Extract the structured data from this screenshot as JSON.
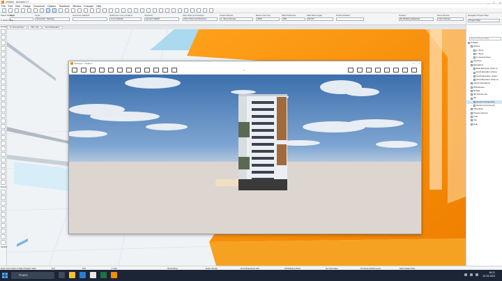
{
  "app": {
    "title": "Untitled - Archicad 27",
    "menu": [
      "File",
      "Edit",
      "View",
      "Design",
      "Document",
      "Options",
      "Teamwork",
      "Window",
      "Enscape",
      "Help"
    ]
  },
  "infobox": {
    "groups": [
      {
        "label": "Main:",
        "value": ""
      },
      {
        "label": "Layer:",
        "value": "Structural - Bearing"
      },
      {
        "label": "Geometry Method:",
        "value": ""
      },
      {
        "label": "Reference Line Location:",
        "value": "Core Outside"
      },
      {
        "label": "Structure:",
        "value": "Generic Wall/S..."
      },
      {
        "label": "Floor Plan and Section:",
        "value": "Floor Plan and Sections..."
      },
      {
        "label": "Linked Stories:",
        "value": "1. Story (Home)"
      },
      {
        "label": "Bottom and Top:",
        "value": "3000"
      },
      {
        "label": "Wall Thickness:",
        "value": "300"
      },
      {
        "label": "Wall Slant Angle:",
        "value": "90.00°"
      },
      {
        "label": "Profile Modifier:",
        "value": ""
      },
      {
        "label": "Surface:",
        "value": "By Building Materials"
      },
      {
        "label": "Final Terrace:",
        "value": "Final Terrace"
      }
    ],
    "select_settings": "Select Settings",
    "story_ground": "0. Ground Floor"
  },
  "tabs": [
    "0. Ground Floor",
    "(3D / All)",
    "South Elevation"
  ],
  "toolbox": {
    "sections": [
      "Design",
      "Document",
      "Variable"
    ],
    "design_tools": 28,
    "document_tools": 10
  },
  "render_window": {
    "title": "Enscape - Untitled",
    "left_icon_names": [
      "home-icon",
      "camera-icon",
      "sun-icon",
      "sync-icon",
      "binoculars-icon",
      "asset-icon",
      "video-icon",
      "screenshot-icon",
      "panorama-icon",
      "image-icon",
      "render-icon",
      "export-icon"
    ],
    "right_icon_names": [
      "view-icon",
      "collab-icon",
      "feedback-icon",
      "material-icon",
      "atmosphere-icon",
      "settings-icon",
      "info-icon",
      "help-icon"
    ]
  },
  "navigator": {
    "header_label": "Navigator Project Map",
    "view_label": "Project Map",
    "search_placeholder": "Search Project Map",
    "items": [
      {
        "label": "Untitled",
        "indent": 0,
        "selected": false
      },
      {
        "label": "Stories",
        "indent": 1,
        "selected": false
      },
      {
        "label": "2. Story",
        "indent": 2,
        "selected": false
      },
      {
        "label": "1. Story",
        "indent": 2,
        "selected": false
      },
      {
        "label": "0. Ground Floor",
        "indent": 2,
        "selected": false
      },
      {
        "label": "Sections",
        "indent": 1,
        "selected": false
      },
      {
        "label": "Elevations",
        "indent": 1,
        "selected": false
      },
      {
        "label": "East Elevation (Auto-re",
        "indent": 2,
        "selected": false
      },
      {
        "label": "North Elevation (Auto-r",
        "indent": 2,
        "selected": false
      },
      {
        "label": "South Elevation (Auto-r",
        "indent": 2,
        "selected": false
      },
      {
        "label": "West Elevation (Auto-re",
        "indent": 2,
        "selected": false
      },
      {
        "label": "Interior Elevations",
        "indent": 1,
        "selected": false
      },
      {
        "label": "Worksheets",
        "indent": 1,
        "selected": false
      },
      {
        "label": "Details",
        "indent": 1,
        "selected": false
      },
      {
        "label": "3D Documents",
        "indent": 1,
        "selected": false
      },
      {
        "label": "3D",
        "indent": 1,
        "selected": false
      },
      {
        "label": "Generic Perspective",
        "indent": 2,
        "selected": true
      },
      {
        "label": "Generic Axonometry",
        "indent": 2,
        "selected": false
      },
      {
        "label": "Schedules",
        "indent": 1,
        "selected": false
      },
      {
        "label": "Project Indexes",
        "indent": 1,
        "selected": false
      },
      {
        "label": "Lists",
        "indent": 1,
        "selected": false
      },
      {
        "label": "Info",
        "indent": 1,
        "selected": false
      },
      {
        "label": "Help",
        "indent": 1,
        "selected": false
      }
    ]
  },
  "statusbar": {
    "items": [
      {
        "text": "Enter First Node of Main Polyline Wall."
      },
      {
        "text": "N/A"
      },
      {
        "text": "N/A"
      },
      {
        "text": "1:100"
      },
      {
        "text": "03 Drafting"
      },
      {
        "text": "Entire Model"
      },
      {
        "text": "02 Architectural 100"
      },
      {
        "text": "03 Building Plans"
      },
      {
        "text": "No Overrides"
      },
      {
        "text": "01 Show All Elements"
      },
      {
        "text": "Main Model Only"
      }
    ]
  },
  "taskbar": {
    "search_placeholder": "Поиск",
    "time": "16:21",
    "date": "22.04.2024"
  },
  "colors": {
    "orange_model": "#f18c00",
    "sky_top": "#3f72b1",
    "ground": "#ddd5cf"
  }
}
